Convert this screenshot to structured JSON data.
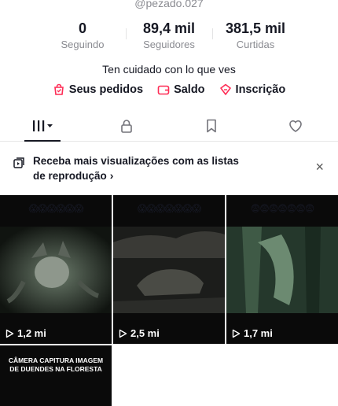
{
  "profile": {
    "username": "@pezado.027",
    "bio": "Ten cuidado con lo que ves"
  },
  "stats": [
    {
      "value": "0",
      "label": "Seguindo"
    },
    {
      "value": "89,4 mil",
      "label": "Seguidores"
    },
    {
      "value": "381,5 mil",
      "label": "Curtidas"
    }
  ],
  "links": [
    {
      "label": "Seus pedidos",
      "icon": "bag-icon"
    },
    {
      "label": "Saldo",
      "icon": "wallet-icon"
    },
    {
      "label": "Inscrição",
      "icon": "ticket-icon"
    }
  ],
  "tabs": [
    "videos-grid",
    "lock",
    "bookmark",
    "heart"
  ],
  "promo": {
    "text": "Receba mais visualizações com as listas de reprodução",
    "chevron": "›",
    "close": "×"
  },
  "videos": [
    {
      "emojis": "😱😱😱😱😱😱",
      "views": "1,2 mi"
    },
    {
      "emojis": "😱😱😱😱😱😱😱",
      "views": "2,5 mi"
    },
    {
      "emojis": "😨😨😨😨😨😨😨",
      "views": "1,7 mi"
    },
    {
      "caption": "CÂMERA CAPITURA IMAGEM DE DUENDES NA FLORESTA"
    }
  ],
  "colors": {
    "accent": "#fe2c55",
    "text": "#161823",
    "muted": "#8a8b91"
  }
}
